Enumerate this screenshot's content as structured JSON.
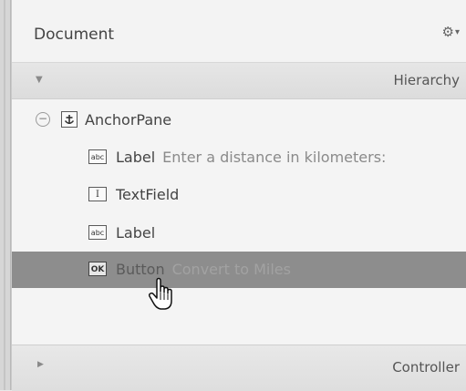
{
  "document_panel": {
    "title": "Document",
    "gear_icon": "gear-icon",
    "hierarchy": {
      "label": "Hierarchy",
      "expanded": true
    },
    "tree": [
      {
        "type": "AnchorPane",
        "description": "",
        "icon": "anchor-icon"
      },
      {
        "type": "Label",
        "description": "Enter a distance in kilometers:",
        "icon": "label-abc-icon",
        "icon_text": "abc"
      },
      {
        "type": "TextField",
        "description": "",
        "icon": "textfield-icon",
        "icon_text": "I"
      },
      {
        "type": "Label",
        "description": "",
        "icon": "label-abc-icon",
        "icon_text": "abc"
      },
      {
        "type": "Button",
        "description": "Convert to Miles",
        "icon": "button-ok-icon",
        "icon_text": "OK",
        "selected": true
      }
    ],
    "controller": {
      "label": "Controller",
      "expanded": false
    }
  }
}
